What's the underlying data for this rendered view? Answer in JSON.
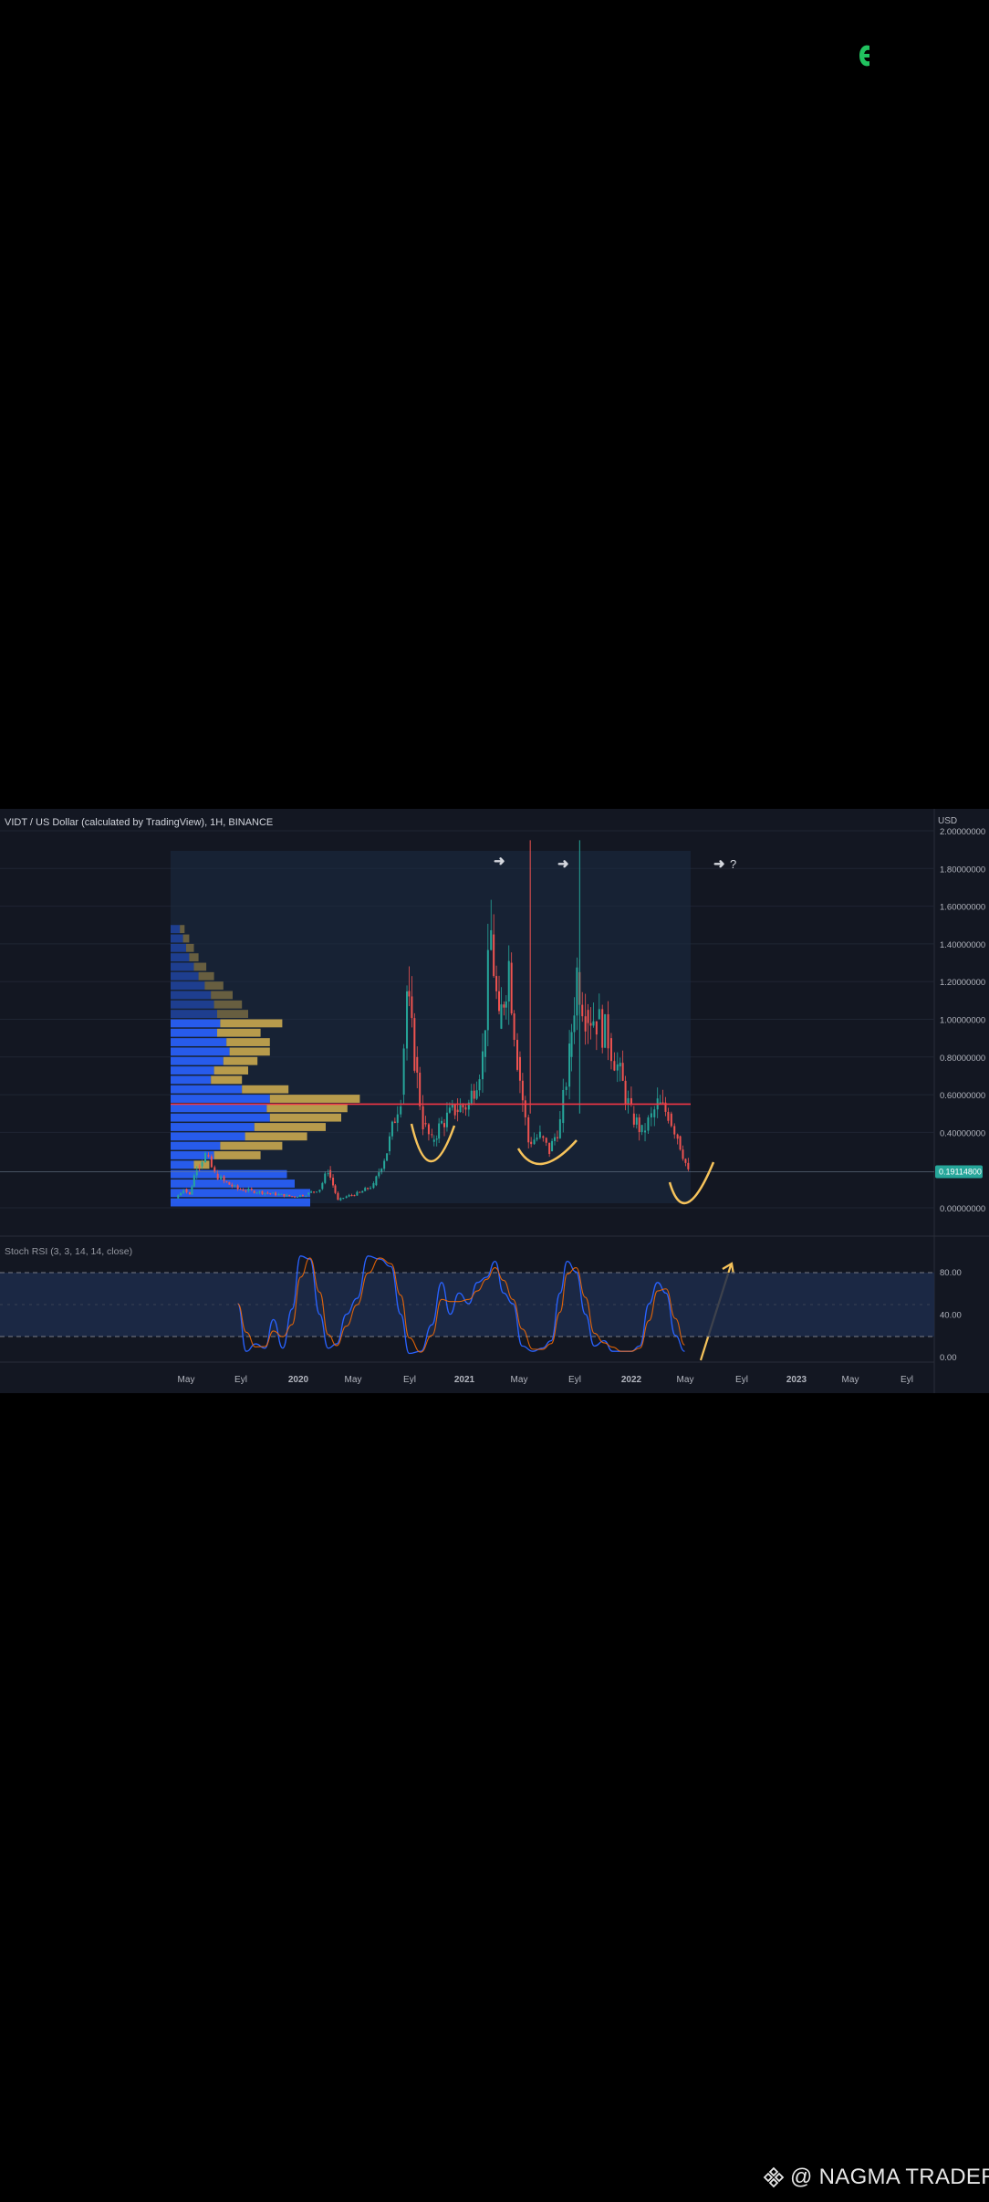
{
  "top_logo": {
    "icon": "green-e-logo",
    "color": "#21c25f"
  },
  "watermark": {
    "icon": "binance-logo",
    "text": "@ NAGMA TRADER"
  },
  "header": {
    "symbol_title": "VIDT / US Dollar (calculated by TradingView), 1H, BINANCE",
    "currency": "USD"
  },
  "price_tag": "0.19114800",
  "question_mark": "?",
  "stoch_label": "Stoch RSI (3, 3, 14, 14, close)",
  "colors": {
    "background": "#131722",
    "up": "#26a69a",
    "down": "#ef5350",
    "profile_blue": "#2962ff",
    "profile_gold": "#c9a84f",
    "annotation": "#f6c35b",
    "k_line": "#2962ff",
    "d_line": "#ff6d00",
    "poc_line": "#f23645"
  },
  "chart_data": [
    {
      "type": "candlestick",
      "title": "VIDT / US Dollar (calculated by TradingView), 1H, BINANCE",
      "y_axis_label": "USD",
      "y_ticks": [
        "2.00000000",
        "1.80000000",
        "1.60000000",
        "1.40000000",
        "1.20000000",
        "1.00000000",
        "0.80000000",
        "0.60000000",
        "0.40000000",
        "0.00000000"
      ],
      "ylim": [
        0,
        2.0
      ],
      "x_ticks": [
        "May",
        "Eyl",
        "2020",
        "May",
        "Eyl",
        "2021",
        "May",
        "Eyl",
        "2022",
        "May",
        "Eyl",
        "2023",
        "May",
        "Eyl"
      ],
      "last_price": 0.191148,
      "poc_price": 0.55,
      "price_series": [
        [
          "2019-03-15",
          0.05
        ],
        [
          "2019-04-01",
          0.1
        ],
        [
          "2019-04-15",
          0.07
        ],
        [
          "2019-05-01",
          0.22
        ],
        [
          "2019-05-20",
          0.28
        ],
        [
          "2019-06-10",
          0.18
        ],
        [
          "2019-07-01",
          0.14
        ],
        [
          "2019-08-01",
          0.1
        ],
        [
          "2019-09-01",
          0.09
        ],
        [
          "2019-10-01",
          0.08
        ],
        [
          "2019-11-01",
          0.07
        ],
        [
          "2019-12-01",
          0.06
        ],
        [
          "2020-01-01",
          0.07
        ],
        [
          "2020-02-01",
          0.1
        ],
        [
          "2020-02-20",
          0.2
        ],
        [
          "2020-03-13",
          0.04
        ],
        [
          "2020-04-01",
          0.06
        ],
        [
          "2020-05-01",
          0.08
        ],
        [
          "2020-06-01",
          0.12
        ],
        [
          "2020-07-01",
          0.3
        ],
        [
          "2020-08-01",
          0.6
        ],
        [
          "2020-08-15",
          1.15
        ],
        [
          "2020-09-01",
          0.8
        ],
        [
          "2020-09-20",
          0.45
        ],
        [
          "2020-10-10",
          0.35
        ],
        [
          "2020-11-01",
          0.45
        ],
        [
          "2020-12-01",
          0.52
        ],
        [
          "2021-01-01",
          0.55
        ],
        [
          "2021-02-01",
          0.8
        ],
        [
          "2021-02-20",
          1.45
        ],
        [
          "2021-03-10",
          0.95
        ],
        [
          "2021-04-01",
          1.3
        ],
        [
          "2021-04-20",
          0.8
        ],
        [
          "2021-05-15",
          0.35
        ],
        [
          "2021-06-10",
          0.38
        ],
        [
          "2021-07-01",
          0.3
        ],
        [
          "2021-07-25",
          0.45
        ],
        [
          "2021-08-15",
          0.8
        ],
        [
          "2021-09-01",
          1.25
        ],
        [
          "2021-09-20",
          1.05
        ],
        [
          "2021-10-15",
          1.0
        ],
        [
          "2021-11-10",
          0.9
        ],
        [
          "2021-12-01",
          0.75
        ],
        [
          "2022-01-01",
          0.5
        ],
        [
          "2022-01-25",
          0.4
        ],
        [
          "2022-02-15",
          0.48
        ],
        [
          "2022-03-01",
          0.55
        ],
        [
          "2022-03-25",
          0.5
        ],
        [
          "2022-04-15",
          0.38
        ],
        [
          "2022-05-09",
          0.19
        ]
      ],
      "volume_profile": [
        {
          "price_low": 0.0,
          "price_high": 0.05,
          "blue": 0.9,
          "gold": 0.0
        },
        {
          "price_low": 0.05,
          "price_high": 0.1,
          "blue": 0.9,
          "gold": 0.0
        },
        {
          "price_low": 0.1,
          "price_high": 0.15,
          "blue": 0.8,
          "gold": 0.0
        },
        {
          "price_low": 0.15,
          "price_high": 0.2,
          "blue": 0.75,
          "gold": 0.0
        },
        {
          "price_low": 0.2,
          "price_high": 0.25,
          "blue": 0.15,
          "gold": 0.1
        },
        {
          "price_low": 0.25,
          "price_high": 0.3,
          "blue": 0.28,
          "gold": 0.3
        },
        {
          "price_low": 0.3,
          "price_high": 0.35,
          "blue": 0.32,
          "gold": 0.4
        },
        {
          "price_low": 0.35,
          "price_high": 0.4,
          "blue": 0.48,
          "gold": 0.4
        },
        {
          "price_low": 0.4,
          "price_high": 0.45,
          "blue": 0.54,
          "gold": 0.46
        },
        {
          "price_low": 0.45,
          "price_high": 0.5,
          "blue": 0.64,
          "gold": 0.46
        },
        {
          "price_low": 0.5,
          "price_high": 0.55,
          "blue": 0.62,
          "gold": 0.52
        },
        {
          "price_low": 0.55,
          "price_high": 0.6,
          "blue": 0.64,
          "gold": 0.58
        },
        {
          "price_low": 0.6,
          "price_high": 0.65,
          "blue": 0.46,
          "gold": 0.3
        },
        {
          "price_low": 0.65,
          "price_high": 0.7,
          "blue": 0.26,
          "gold": 0.2
        },
        {
          "price_low": 0.7,
          "price_high": 0.75,
          "blue": 0.28,
          "gold": 0.22
        },
        {
          "price_low": 0.75,
          "price_high": 0.8,
          "blue": 0.34,
          "gold": 0.22
        },
        {
          "price_low": 0.8,
          "price_high": 0.85,
          "blue": 0.38,
          "gold": 0.26
        },
        {
          "price_low": 0.85,
          "price_high": 0.9,
          "blue": 0.36,
          "gold": 0.28
        },
        {
          "price_low": 0.9,
          "price_high": 0.95,
          "blue": 0.3,
          "gold": 0.28
        },
        {
          "price_low": 0.95,
          "price_high": 1.0,
          "blue": 0.32,
          "gold": 0.4
        },
        {
          "price_low": 1.0,
          "price_high": 1.05,
          "blue": 0.3,
          "gold": 0.2
        },
        {
          "price_low": 1.05,
          "price_high": 1.1,
          "blue": 0.28,
          "gold": 0.18
        },
        {
          "price_low": 1.1,
          "price_high": 1.15,
          "blue": 0.26,
          "gold": 0.14
        },
        {
          "price_low": 1.15,
          "price_high": 1.2,
          "blue": 0.22,
          "gold": 0.12
        },
        {
          "price_low": 1.2,
          "price_high": 1.25,
          "blue": 0.18,
          "gold": 0.1
        },
        {
          "price_low": 1.25,
          "price_high": 1.3,
          "blue": 0.15,
          "gold": 0.08
        },
        {
          "price_low": 1.3,
          "price_high": 1.35,
          "blue": 0.12,
          "gold": 0.06
        },
        {
          "price_low": 1.35,
          "price_high": 1.4,
          "blue": 0.1,
          "gold": 0.05
        },
        {
          "price_low": 1.4,
          "price_high": 1.45,
          "blue": 0.08,
          "gold": 0.04
        },
        {
          "price_low": 1.45,
          "price_high": 1.5,
          "blue": 0.06,
          "gold": 0.03
        }
      ]
    },
    {
      "type": "line",
      "title": "Stoch RSI (3, 3, 14, 14, close)",
      "y_ticks": [
        "80.00",
        "40.00",
        "0.00"
      ],
      "ylim": [
        0,
        100
      ],
      "bands": [
        20,
        80
      ],
      "series": [
        {
          "values": [
            [
              "2019-08-01",
              50
            ],
            [
              "2019-08-20",
              5
            ],
            [
              "2019-09-10",
              12
            ],
            [
              "2019-10-01",
              8
            ],
            [
              "2019-10-20",
              35
            ],
            [
              "2019-11-10",
              8
            ],
            [
              "2019-12-01",
              45
            ],
            [
              "2019-12-20",
              95
            ],
            [
              "2020-01-10",
              92
            ],
            [
              "2020-02-01",
              40
            ],
            [
              "2020-02-20",
              8
            ],
            [
              "2020-03-10",
              12
            ],
            [
              "2020-04-01",
              40
            ],
            [
              "2020-04-25",
              55
            ],
            [
              "2020-05-20",
              95
            ],
            [
              "2020-06-15",
              92
            ],
            [
              "2020-07-10",
              85
            ],
            [
              "2020-08-01",
              40
            ],
            [
              "2020-08-20",
              3
            ],
            [
              "2020-09-15",
              5
            ],
            [
              "2020-10-10",
              30
            ],
            [
              "2020-11-01",
              70
            ],
            [
              "2020-11-20",
              40
            ],
            [
              "2020-12-10",
              60
            ],
            [
              "2021-01-01",
              50
            ],
            [
              "2021-01-20",
              70
            ],
            [
              "2021-02-10",
              75
            ],
            [
              "2021-03-01",
              90
            ],
            [
              "2021-03-20",
              60
            ],
            [
              "2021-04-10",
              50
            ],
            [
              "2021-05-01",
              10
            ],
            [
              "2021-05-25",
              5
            ],
            [
              "2021-06-15",
              8
            ],
            [
              "2021-07-05",
              15
            ],
            [
              "2021-07-25",
              60
            ],
            [
              "2021-08-10",
              90
            ],
            [
              "2021-08-30",
              80
            ],
            [
              "2021-09-20",
              40
            ],
            [
              "2021-10-10",
              10
            ],
            [
              "2021-11-01",
              15
            ],
            [
              "2021-11-20",
              5
            ],
            [
              "2021-12-10",
              5
            ],
            [
              "2022-01-01",
              5
            ],
            [
              "2022-01-20",
              10
            ],
            [
              "2022-02-10",
              50
            ],
            [
              "2022-03-01",
              70
            ],
            [
              "2022-03-20",
              60
            ],
            [
              "2022-04-10",
              20
            ],
            [
              "2022-05-01",
              5
            ]
          ]
        }
      ]
    }
  ]
}
